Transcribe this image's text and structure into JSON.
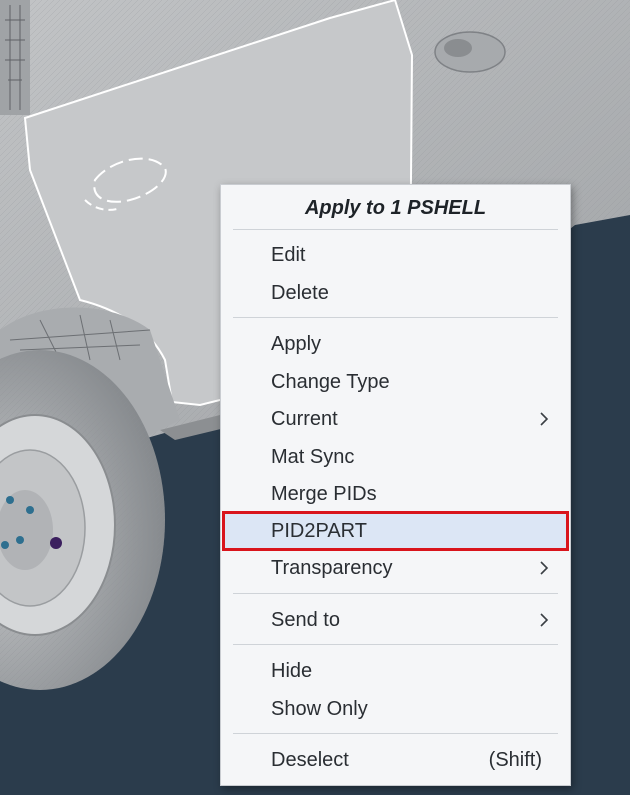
{
  "context_menu": {
    "header": "Apply to 1 PSHELL",
    "items": [
      {
        "label": "Edit"
      },
      {
        "label": "Delete"
      },
      {
        "label": "Apply"
      },
      {
        "label": "Change Type"
      },
      {
        "label": "Current",
        "submenu": true
      },
      {
        "label": "Mat Sync"
      },
      {
        "label": "Merge PIDs"
      },
      {
        "label": "PID2PART",
        "highlighted": true
      },
      {
        "label": "Transparency",
        "submenu": true
      },
      {
        "label": "Send to",
        "submenu": true
      },
      {
        "label": "Hide"
      },
      {
        "label": "Show Only"
      },
      {
        "label": "Deselect",
        "shortcut": "(Shift)"
      }
    ],
    "highlight_color": "#d9141c"
  },
  "viewport": {
    "background_color": "#2b3c4c",
    "model_color": "#b8babc",
    "icons": [
      "chevron-right-icon"
    ]
  }
}
